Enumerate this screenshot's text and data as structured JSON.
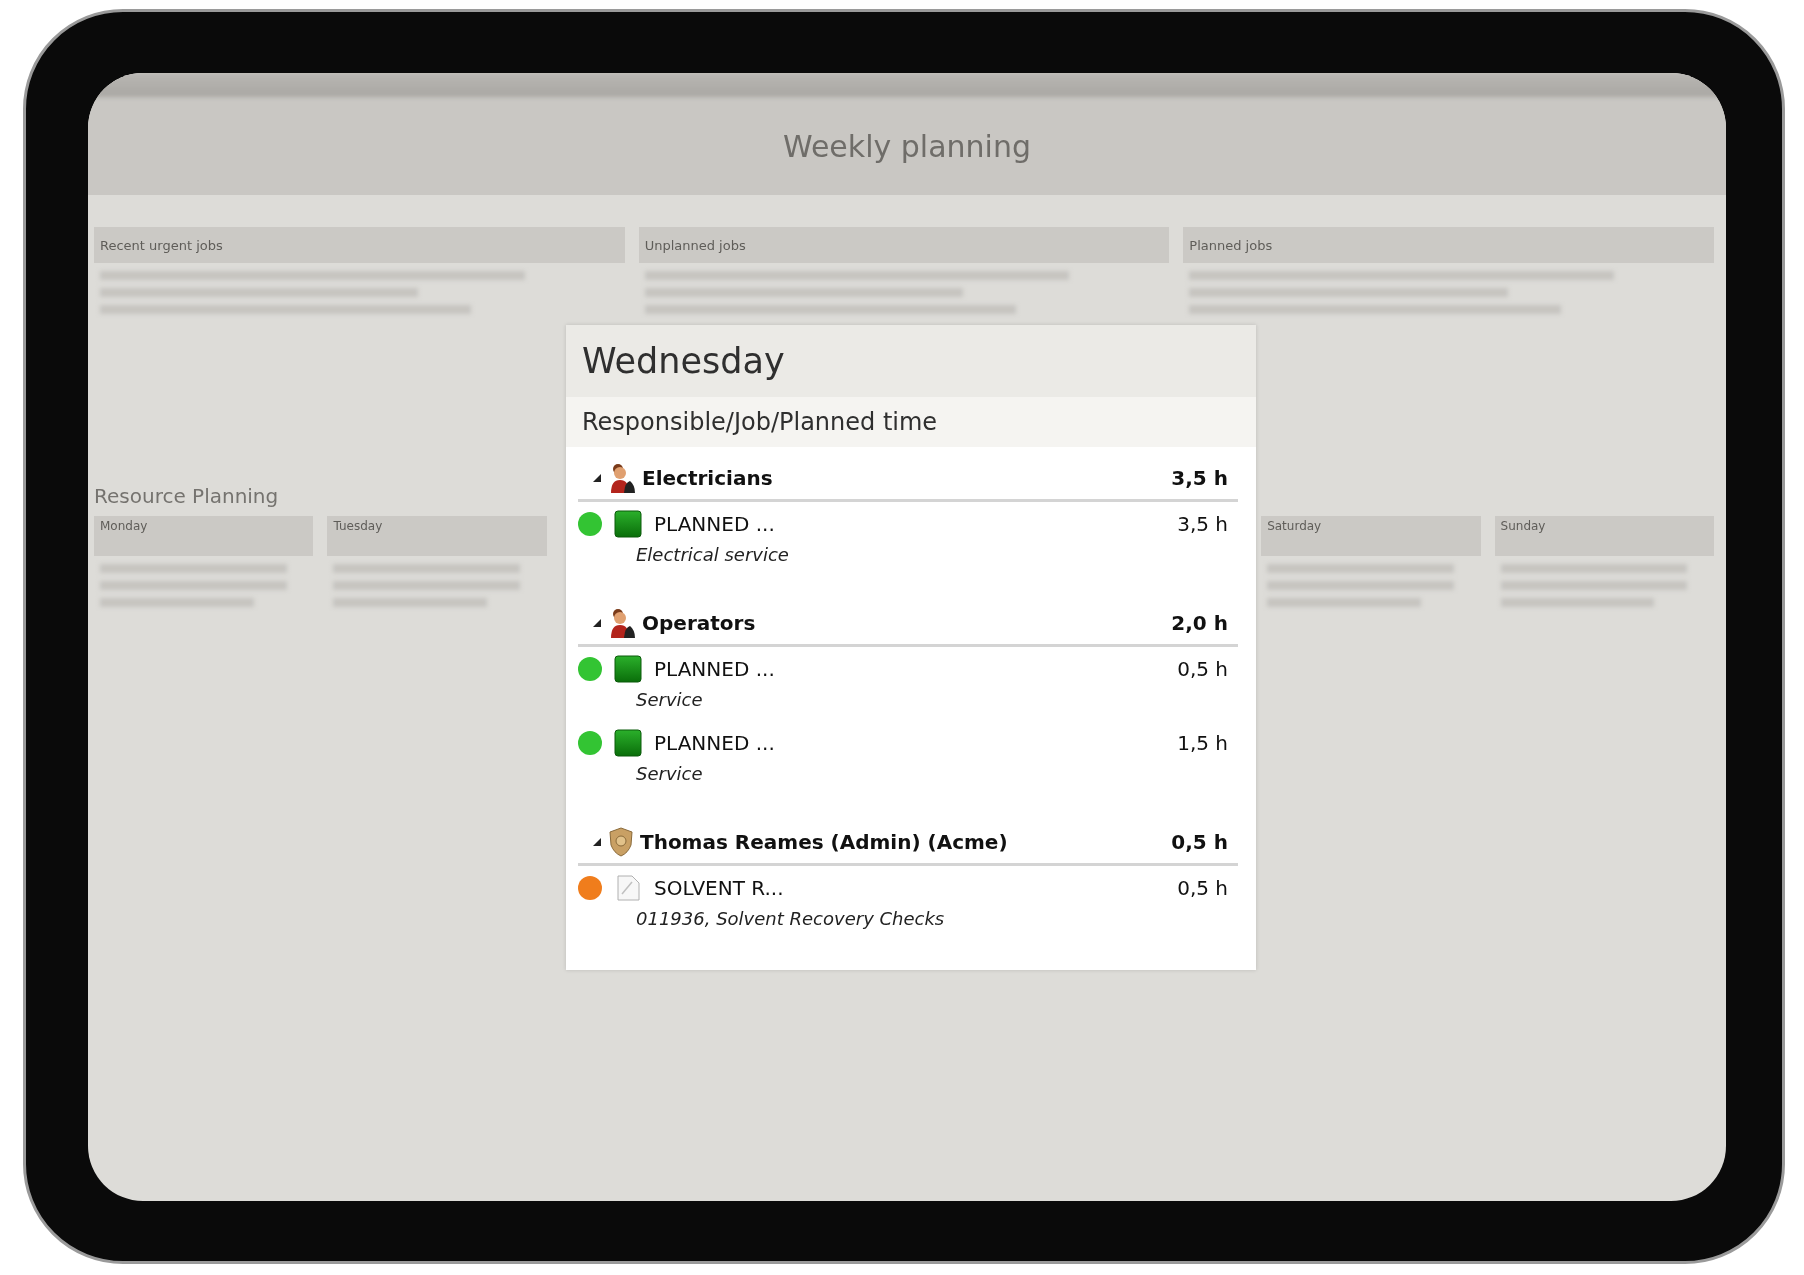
{
  "page": {
    "title": "Weekly planning"
  },
  "panels": [
    {
      "title": "Recent urgent jobs"
    },
    {
      "title": "Unplanned jobs"
    },
    {
      "title": "Planned jobs"
    }
  ],
  "resource_planning": {
    "title": "Resource Planning",
    "days": [
      {
        "label": "Monday"
      },
      {
        "label": "Tuesday"
      },
      {
        "label": "Saturday"
      },
      {
        "label": "Sunday"
      }
    ]
  },
  "popup": {
    "title": "Wednesday",
    "header": "Responsible/Job/Planned time",
    "groups": [
      {
        "name": "Electricians",
        "kind": "team",
        "total": "3,5 h",
        "expanded": true,
        "jobs": [
          {
            "color": "#33c433",
            "kind": "planned",
            "title": "PLANNED ...",
            "hours": "3,5 h",
            "description": "Electrical service"
          }
        ]
      },
      {
        "name": "Operators",
        "kind": "team",
        "total": "2,0 h",
        "expanded": true,
        "jobs": [
          {
            "color": "#33c433",
            "kind": "planned",
            "title": "PLANNED ...",
            "hours": "0,5 h",
            "description": "Service"
          },
          {
            "color": "#33c433",
            "kind": "planned",
            "title": "PLANNED ...",
            "hours": "1,5 h",
            "description": "Service"
          }
        ]
      },
      {
        "name": "Thomas Reames (Admin) (Acme)",
        "kind": "admin",
        "total": "0,5 h",
        "expanded": true,
        "jobs": [
          {
            "color": "#f07d1c",
            "kind": "document",
            "title": "SOLVENT R...",
            "hours": "0,5 h",
            "description": "011936, Solvent Recovery Checks"
          }
        ]
      }
    ]
  }
}
